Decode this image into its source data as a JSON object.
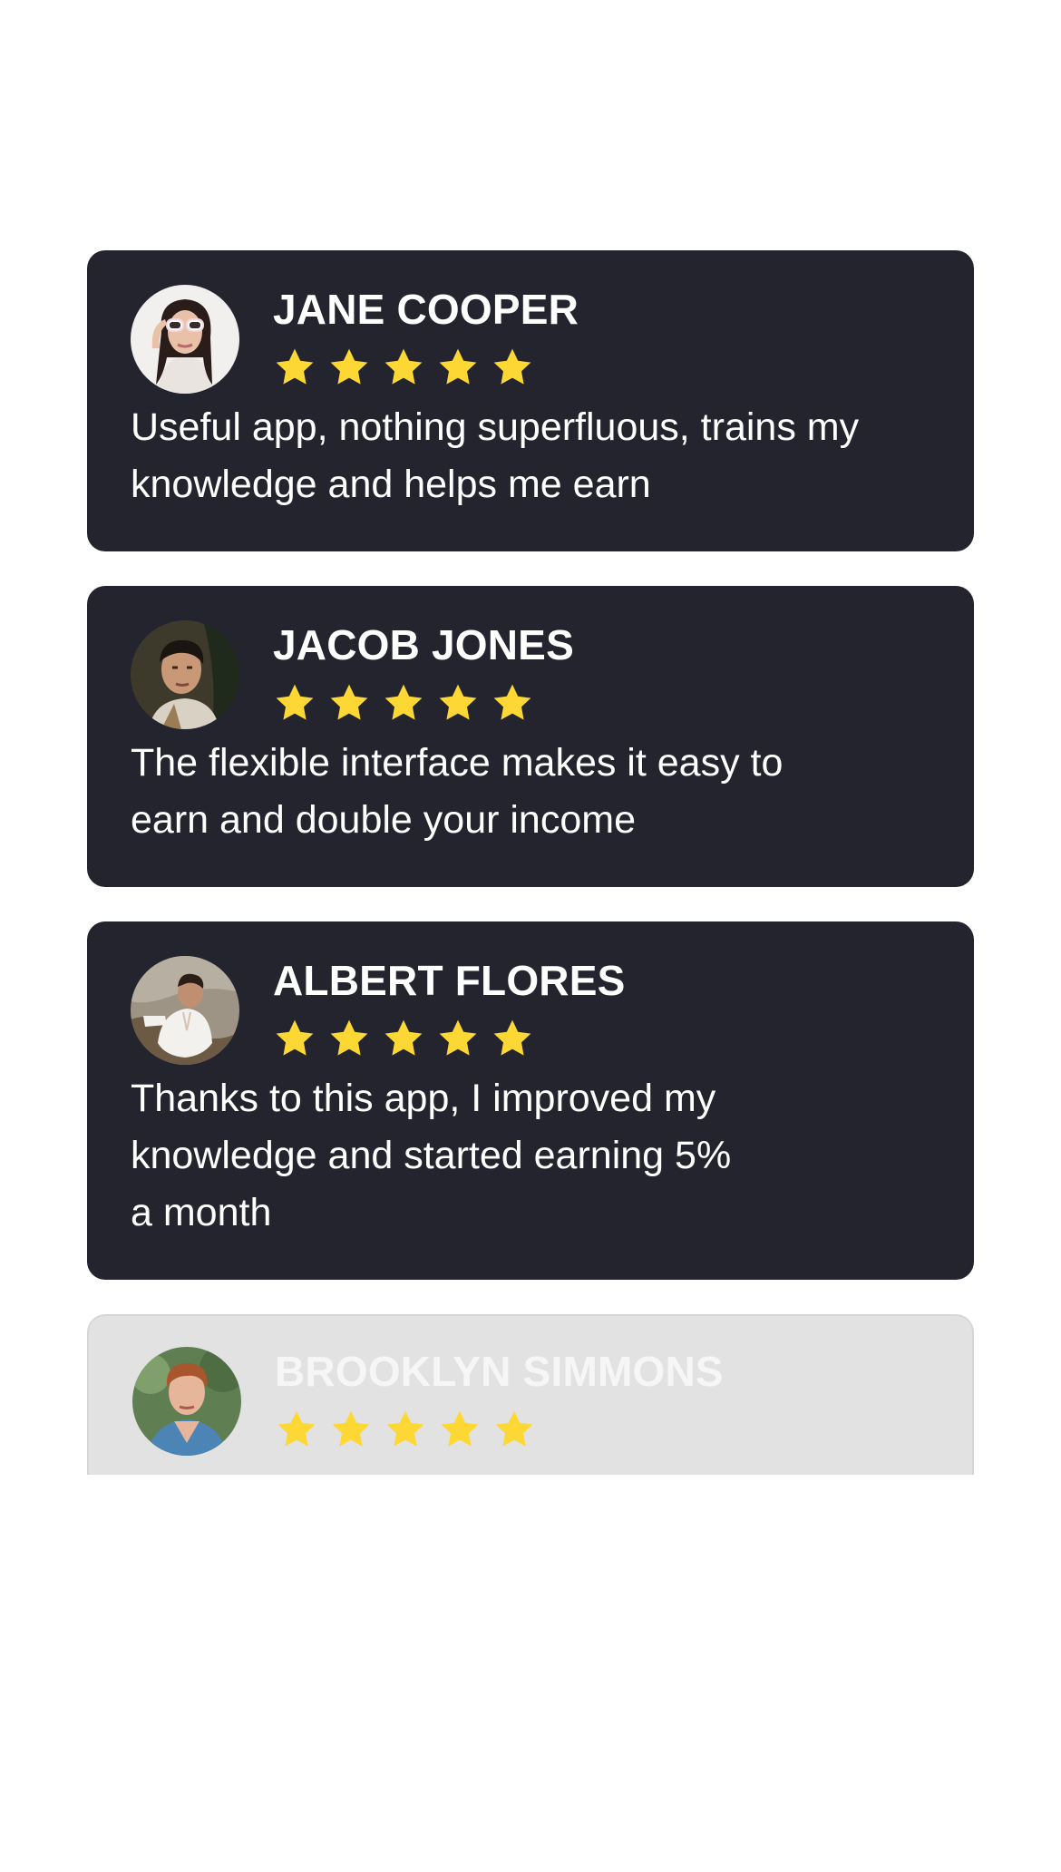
{
  "colors": {
    "card_bg": "#24242f",
    "card_faded_bg": "#e2e2e2",
    "star": "#fdd835",
    "text": "#ffffff"
  },
  "reviews": [
    {
      "name": "JANE COOPER",
      "rating": 5,
      "text": "Useful app, nothing superfluous, trains my\nknowledge and helps me earn",
      "avatar_icon": "woman-with-sunglasses-avatar"
    },
    {
      "name": "JACOB JONES",
      "rating": 5,
      "text": "The flexible interface makes it easy to\nearn and double your income",
      "avatar_icon": "man-portrait-avatar"
    },
    {
      "name": "ALBERT FLORES",
      "rating": 5,
      "text": "Thanks to this app, I improved my\nknowledge and started earning 5%\na month",
      "avatar_icon": "man-white-shirt-avatar"
    },
    {
      "name": "BROOKLYN SIMMONS",
      "rating": 5,
      "avatar_icon": "man-denim-shirt-avatar"
    }
  ]
}
